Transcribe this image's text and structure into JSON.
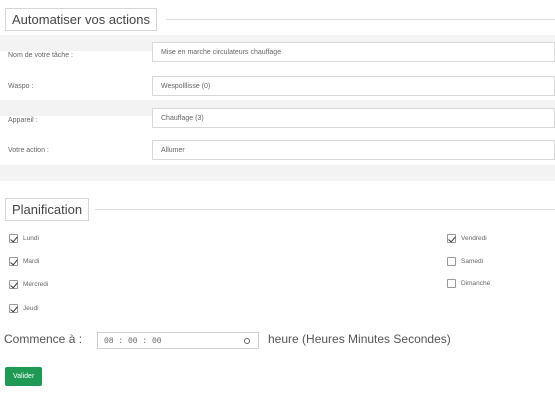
{
  "automation": {
    "title": "Automatiser vos actions",
    "fields": [
      {
        "label": "Nom de votre tâche :",
        "value": "Mise en marche circulateurs chauffage"
      },
      {
        "label": "Waspo :",
        "value": "Wespolllisse (0)"
      },
      {
        "label": "Appareil :",
        "value": "Chauffage (3)"
      },
      {
        "label": "Votre action :",
        "value": "Allumer"
      }
    ]
  },
  "planning": {
    "title": "Planification",
    "days": [
      {
        "label": "Lundi",
        "checked": true
      },
      {
        "label": "Mardi",
        "checked": true
      },
      {
        "label": "Mercredi",
        "checked": true
      },
      {
        "label": "Jeudi",
        "checked": true
      },
      {
        "label": "Vendredi",
        "checked": true
      },
      {
        "label": "Samedi",
        "checked": false
      },
      {
        "label": "Dimanche",
        "checked": false
      }
    ]
  },
  "start": {
    "label": "Commence à :",
    "time_value": "08 : 00 : 00",
    "unit_text": "heure (Heures Minutes Secondes)",
    "icon": "clock-icon"
  },
  "actions": {
    "submit_label": "Valider",
    "accent": "#1f9a54"
  }
}
